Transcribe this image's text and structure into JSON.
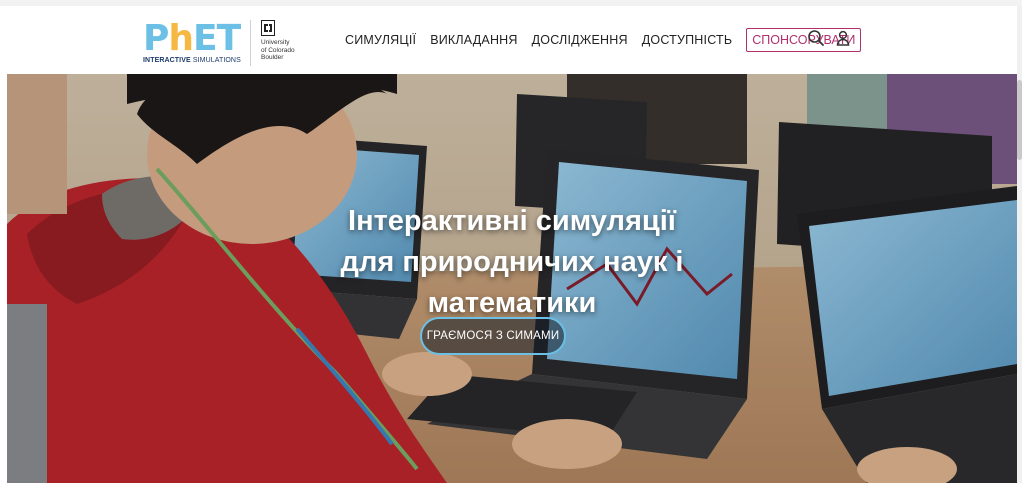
{
  "header": {
    "logo": {
      "wordmark_main": "PhET",
      "tagline_bold": "INTERACTIVE",
      "tagline_rest": " SIMULATIONS"
    },
    "university": {
      "lines": [
        "University",
        "of Colorado",
        "Boulder"
      ]
    },
    "nav": {
      "items": [
        {
          "label": "СИМУЛЯЦІЇ"
        },
        {
          "label": "ВИКЛАДАННЯ"
        },
        {
          "label": "ДОСЛІДЖЕННЯ"
        },
        {
          "label": "ДОСТУПНІСТЬ"
        }
      ],
      "donate_label": "СПОНСОРУВАТИ"
    },
    "icons": {
      "search": "search-icon",
      "account": "user-icon"
    }
  },
  "hero": {
    "title_lines": [
      "Інтерактивні симуляції",
      "для природничих наук і",
      "математики"
    ],
    "cta_label": "ГРАЄМОСЯ З СИМАМИ"
  },
  "colors": {
    "brand_blue": "#6cc0e5",
    "brand_yellow": "#f4b843",
    "donate_magenta": "#b0306e"
  }
}
